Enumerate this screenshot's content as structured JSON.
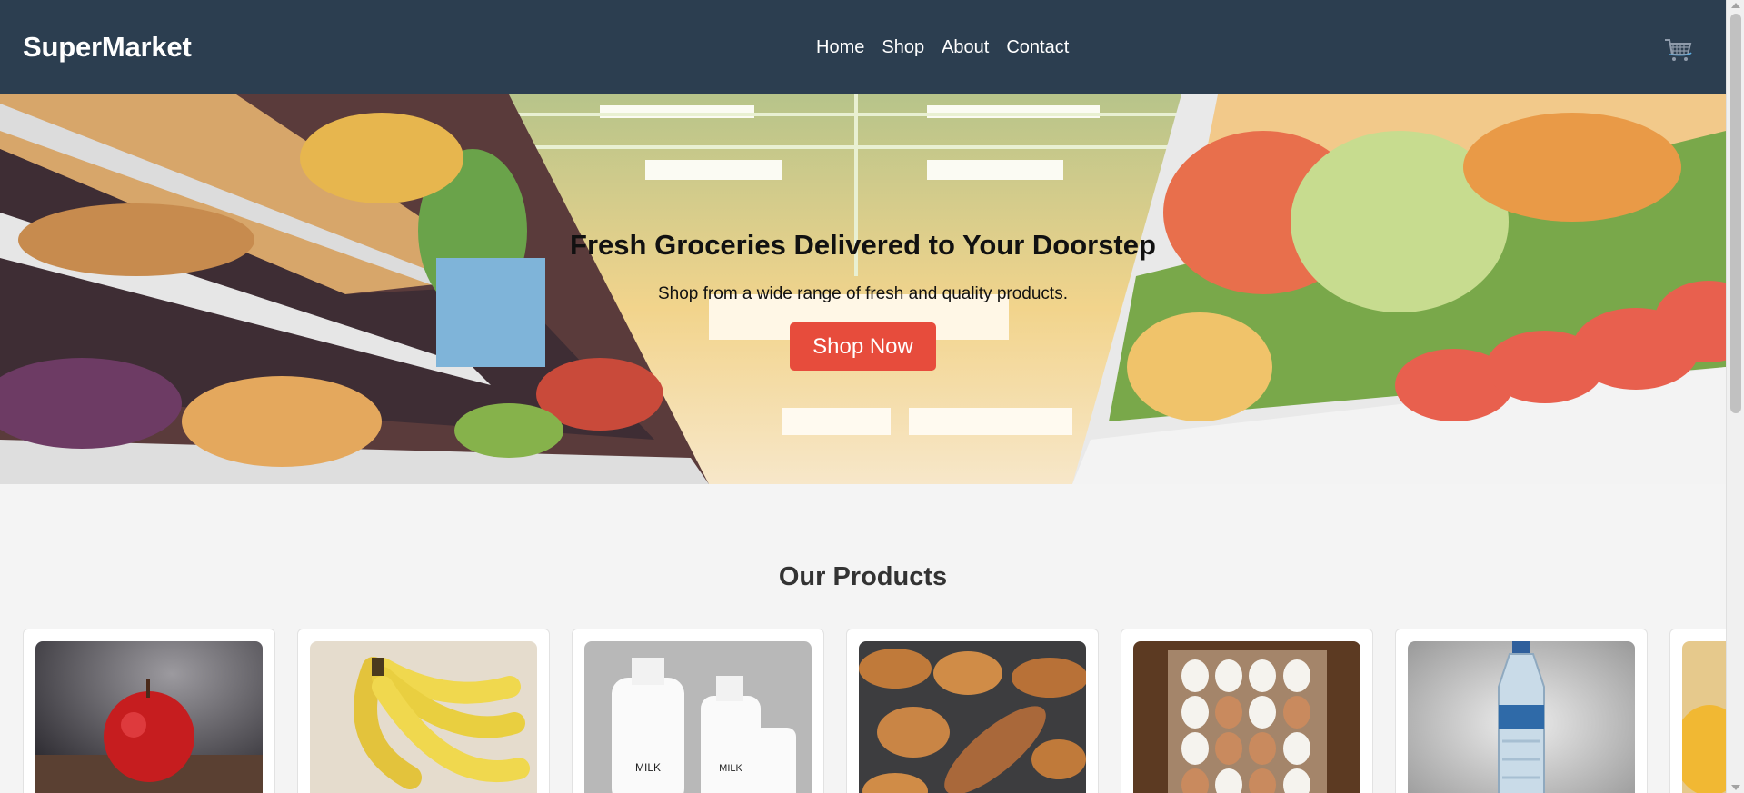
{
  "header": {
    "logo": "SuperMarket",
    "nav": [
      "Home",
      "Shop",
      "About",
      "Contact"
    ],
    "cart_icon": "shopping-cart-icon"
  },
  "hero": {
    "title": "Fresh Groceries Delivered to Your Doorstep",
    "subtitle": "Shop from a wide range of fresh and quality products.",
    "button_label": "Shop Now"
  },
  "products": {
    "title": "Our Products",
    "items": [
      {
        "image": "apple"
      },
      {
        "image": "bananas"
      },
      {
        "image": "milk-bottles"
      },
      {
        "image": "bread"
      },
      {
        "image": "eggs"
      },
      {
        "image": "water-bottle"
      },
      {
        "image": "cheese"
      }
    ]
  },
  "colors": {
    "header_bg": "#2c3e50",
    "accent": "#e74c3c",
    "page_bg": "#f4f4f4"
  }
}
